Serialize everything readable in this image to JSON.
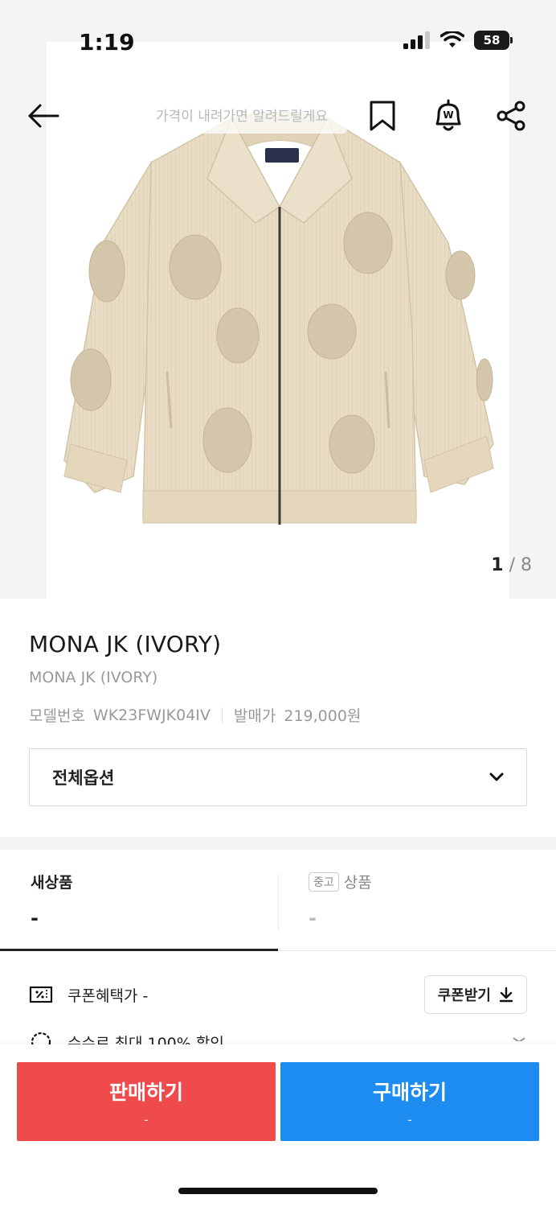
{
  "status_bar": {
    "time": "1:19",
    "battery": "58"
  },
  "header": {
    "price_alert_tip": "가격이 내려가면 알려드릴게요"
  },
  "gallery": {
    "current_page": "1",
    "total_pages": "8",
    "separator": "/"
  },
  "product": {
    "title": "MONA JK (IVORY)",
    "subtitle": "MONA JK (IVORY)",
    "model_label": "모델번호",
    "model_number": "WK23FWJK04IV",
    "release_price_label": "발매가",
    "release_price": "219,000원"
  },
  "options": {
    "select_label": "전체옵션"
  },
  "condition_tabs": [
    {
      "label": "새상품",
      "price": "-"
    },
    {
      "badge": "중고",
      "label": "상품",
      "price": "-"
    }
  ],
  "coupon": {
    "label": "쿠폰혜택가 -",
    "button": "쿠폰받기"
  },
  "discount": {
    "label": "수수료 최대 100% 할인"
  },
  "bottom_bar": {
    "sell": {
      "label": "판매하기",
      "price": "-"
    },
    "buy": {
      "label": "구매하기",
      "price": "-"
    }
  },
  "colors": {
    "sell": "#f04b4c",
    "buy": "#1d8cf0",
    "accent": "#222222"
  }
}
